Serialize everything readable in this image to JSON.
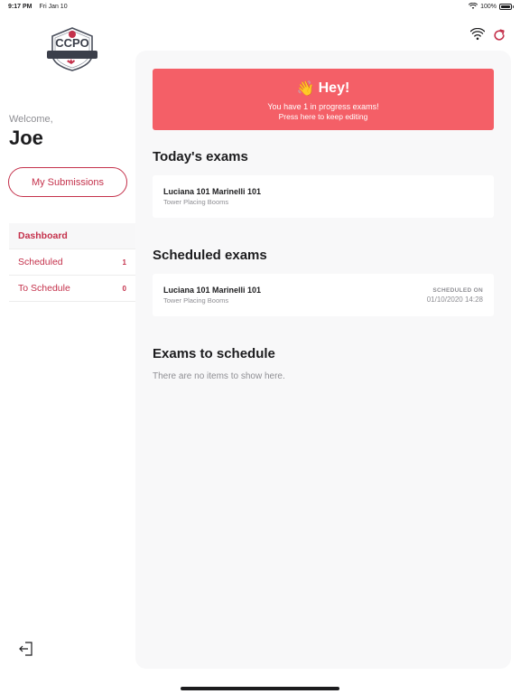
{
  "status_bar": {
    "time": "9:17 PM",
    "date": "Fri Jan 10",
    "battery": "100%",
    "battery_level": 1.0
  },
  "sidebar": {
    "logo_text": "CCPO",
    "welcome": "Welcome,",
    "username": "Joe",
    "submissions_button": "My Submissions",
    "nav": [
      {
        "label": "Dashboard",
        "count": "",
        "active": true
      },
      {
        "label": "Scheduled",
        "count": "1",
        "active": false
      },
      {
        "label": "To Schedule",
        "count": "0",
        "active": false
      }
    ]
  },
  "banner": {
    "emoji": "👋",
    "title": "Hey!",
    "line1": "You have 1 in progress exams!",
    "line2": "Press here to keep editing"
  },
  "todays_exams": {
    "title": "Today's exams",
    "items": [
      {
        "name": "Luciana 101 Marinelli 101",
        "subtitle": "Tower Placing Booms"
      }
    ]
  },
  "scheduled_exams": {
    "title": "Scheduled exams",
    "items": [
      {
        "name": "Luciana 101 Marinelli 101",
        "subtitle": "Tower Placing Booms",
        "scheduled_label": "SCHEDULED ON",
        "scheduled_value": "01/10/2020 14:28"
      }
    ]
  },
  "exams_to_schedule": {
    "title": "Exams to schedule",
    "empty": "There are no items to show here."
  },
  "colors": {
    "accent": "#c4314b",
    "banner": "#f45f67",
    "panel": "#f8f8f9"
  }
}
